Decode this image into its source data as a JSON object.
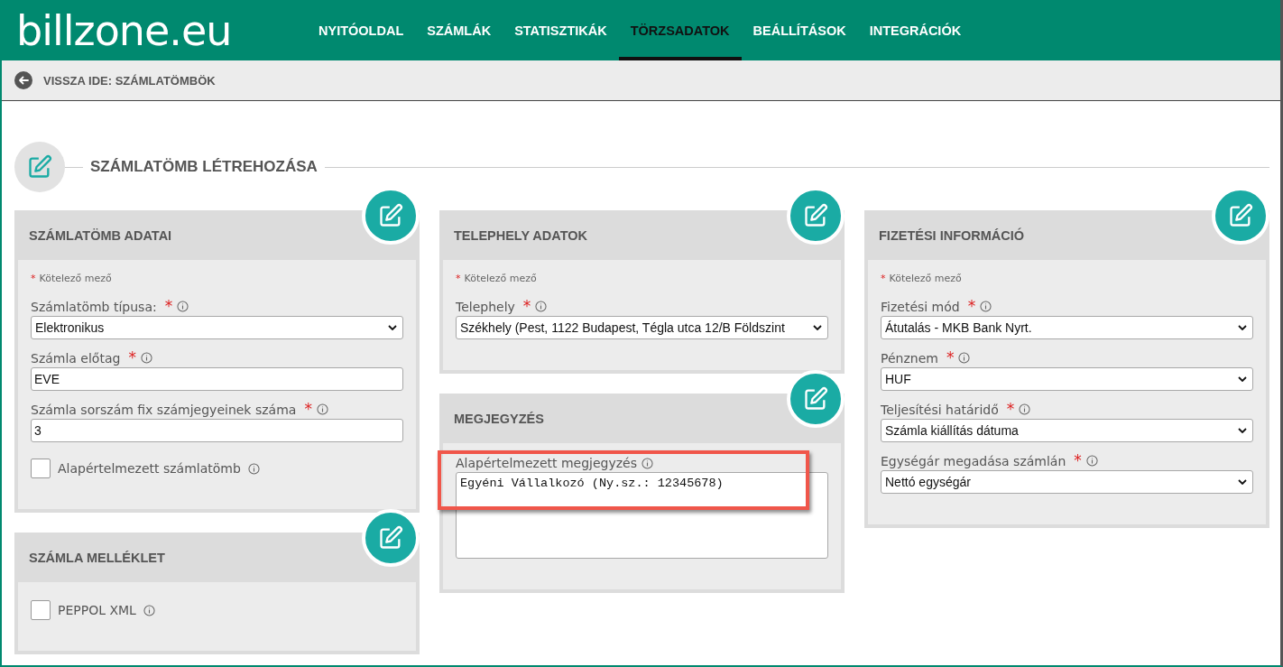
{
  "header": {
    "logo": "billzone.eu",
    "nav": [
      {
        "label": "NYITÓOLDAL",
        "selected": false
      },
      {
        "label": "SZÁMLÁK",
        "selected": false
      },
      {
        "label": "STATISZTIKÁK",
        "selected": false
      },
      {
        "label": "TÖRZSADATOK",
        "selected": true
      },
      {
        "label": "BEÁLLÍTÁSOK",
        "selected": false
      },
      {
        "label": "INTEGRÁCIÓK",
        "selected": false
      }
    ]
  },
  "back_link": {
    "label": "VISSZA IDE: SZÁMLATÖMBÖK"
  },
  "section_title": "SZÁMLATÖMB LÉTREHOZÁSA",
  "columns": [
    {
      "panels": [
        {
          "title": "SZÁMLATÖMB ADATAI",
          "required_note": {
            "mark": "*",
            "text": "Kötelező mező"
          },
          "fields": [
            {
              "kind": "select",
              "label": "Számlatömb típusa:",
              "required_mark": "*",
              "value": "Elektronikus",
              "highlighted": false
            },
            {
              "kind": "input",
              "label": "Számla előtag",
              "required_mark": "*",
              "value": "EVE",
              "highlighted": false
            },
            {
              "kind": "input",
              "label": "Számla sorszám fix számjegyeinek száma",
              "required_mark": "*",
              "value": "3",
              "highlighted": false
            },
            {
              "kind": "checkbox",
              "label": "Alapértelmezett számlatömb",
              "checked": false,
              "highlighted": false
            }
          ]
        },
        {
          "title": "SZÁMLA MELLÉKLET",
          "fields": [
            {
              "kind": "checkbox",
              "label": "PEPPOL XML",
              "checked": false,
              "highlighted": false
            }
          ]
        }
      ]
    },
    {
      "panels": [
        {
          "title": "TELEPHELY ADATOK",
          "required_note": {
            "mark": "*",
            "text": "Kötelező mező"
          },
          "fields": [
            {
              "kind": "select",
              "label": "Telephely",
              "required_mark": "*",
              "value": "Székhely (Pest, 1122 Budapest, Tégla utca 12/B Földszint",
              "highlighted": false
            }
          ]
        },
        {
          "title": "MEGJEGYZÉS",
          "fields": [
            {
              "kind": "textarea",
              "label": "Alapértelmezett megjegyzés",
              "value": "Egyéni Vállalkozó (Ny.sz.: 12345678)",
              "highlighted": true
            }
          ]
        }
      ]
    },
    {
      "panels": [
        {
          "title": "FIZETÉSI INFORMÁCIÓ",
          "required_note": {
            "mark": "*",
            "text": "Kötelező mező"
          },
          "fields": [
            {
              "kind": "select",
              "label": "Fizetési mód",
              "required_mark": "*",
              "value": "Átutalás - MKB Bank Nyrt.",
              "highlighted": false
            },
            {
              "kind": "select",
              "label": "Pénznem",
              "required_mark": "*",
              "value": "HUF",
              "highlighted": false
            },
            {
              "kind": "select",
              "label": "Teljesítési határidő",
              "required_mark": "*",
              "value": "Számla kiállítás dátuma",
              "highlighted": false
            },
            {
              "kind": "select",
              "label": "Egységár megadása számlán",
              "required_mark": "*",
              "value": "Nettó egységár",
              "highlighted": false
            }
          ]
        }
      ]
    }
  ]
}
